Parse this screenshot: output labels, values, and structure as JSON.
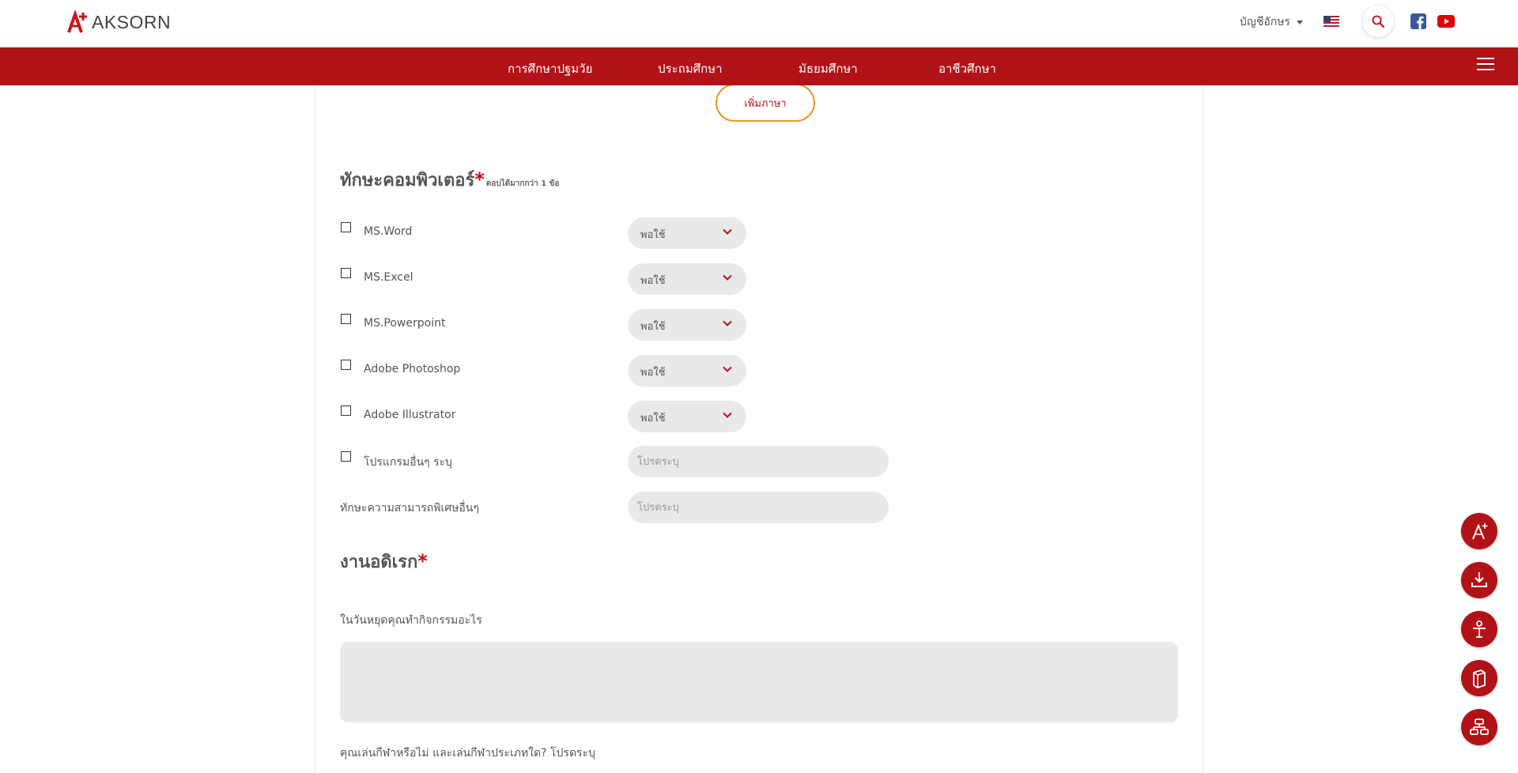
{
  "header": {
    "logo_text": "AKSORN",
    "account_label": "บัญชีอักษร",
    "search_icon": "search-icon",
    "social": [
      "facebook-icon",
      "youtube-icon"
    ]
  },
  "nav": {
    "items": [
      {
        "label": "การศึกษาปฐมวัย"
      },
      {
        "label": "ประถมศึกษา"
      },
      {
        "label": "มัธยมศึกษา"
      },
      {
        "label": "อาชีวศึกษา"
      }
    ]
  },
  "form": {
    "add_language_label": "เพิ่มภาษา",
    "computer_skills": {
      "title": "ทักษะคอมพิวเตอร์",
      "required_mark": "*",
      "hint": "ตอบได้มากกว่า 1 ข้อ",
      "items": [
        {
          "label": "MS.Word",
          "level": "พอใช้",
          "checked": false
        },
        {
          "label": "MS.Excel",
          "level": "พอใช้",
          "checked": false
        },
        {
          "label": "MS.Powerpoint",
          "level": "พอใช้",
          "checked": false
        },
        {
          "label": "Adobe Photoshop",
          "level": "พอใช้",
          "checked": false
        },
        {
          "label": "Adobe Illustrator",
          "level": "พอใช้",
          "checked": false
        }
      ],
      "other_program_label": "โปรแกรมอื่นๆ ระบุ",
      "other_program_placeholder": "โปรดระบุ",
      "special_skill_label": "ทักษะความสามารถพิเศษอื่นๆ",
      "special_skill_placeholder": "โปรดระบุ"
    },
    "hobbies": {
      "title": "งานอดิเรก",
      "required_mark": "*",
      "q1_label": "ในวันหยุดคุณทำกิจกรรมอะไร",
      "q1_value": "",
      "q2_label": "คุณเล่นกีฬาหรือไม่ และเล่นกีฬาประเภทใด? โปรดระบุ"
    }
  },
  "floating_buttons": [
    "aksorn-logo-icon",
    "download-icon",
    "teacher-icon",
    "books-icon",
    "network-icon"
  ],
  "colors": {
    "brand_red": "#b01218",
    "accent_orange": "#f0922b",
    "input_gray": "#e9e9e9"
  }
}
